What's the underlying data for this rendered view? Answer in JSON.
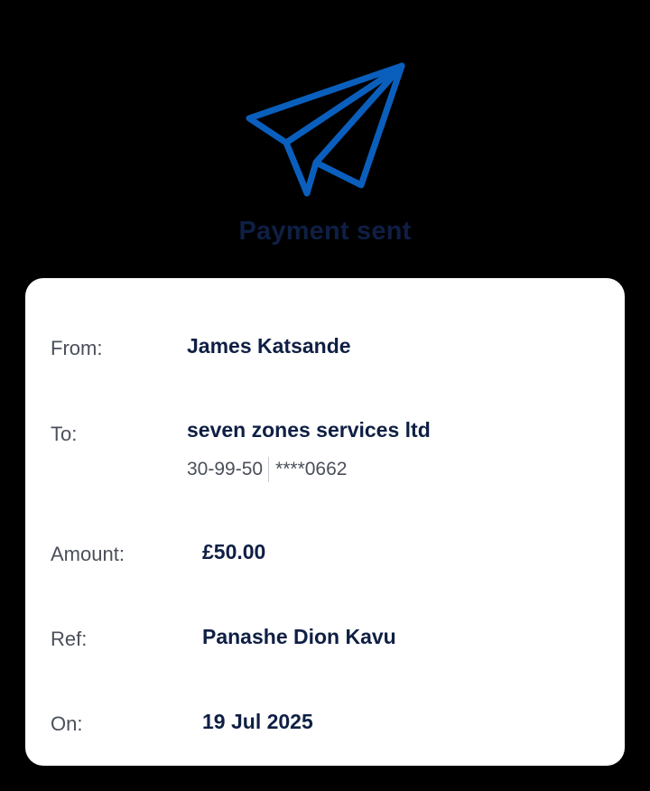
{
  "header": {
    "title": "Payment sent",
    "icon": "paper-plane-icon",
    "accent_color": "#0a5fbd"
  },
  "details": {
    "from": {
      "label": "From:",
      "value": "James Katsande"
    },
    "to": {
      "label": "To:",
      "value": "seven zones services ltd",
      "sort_code": "30-99-50",
      "account": "****0662"
    },
    "amount": {
      "label": "Amount:",
      "value": "£50.00"
    },
    "ref": {
      "label": "Ref:",
      "value": "Panashe Dion Kavu"
    },
    "on": {
      "label": "On:",
      "value": "19 Jul 2025"
    }
  }
}
